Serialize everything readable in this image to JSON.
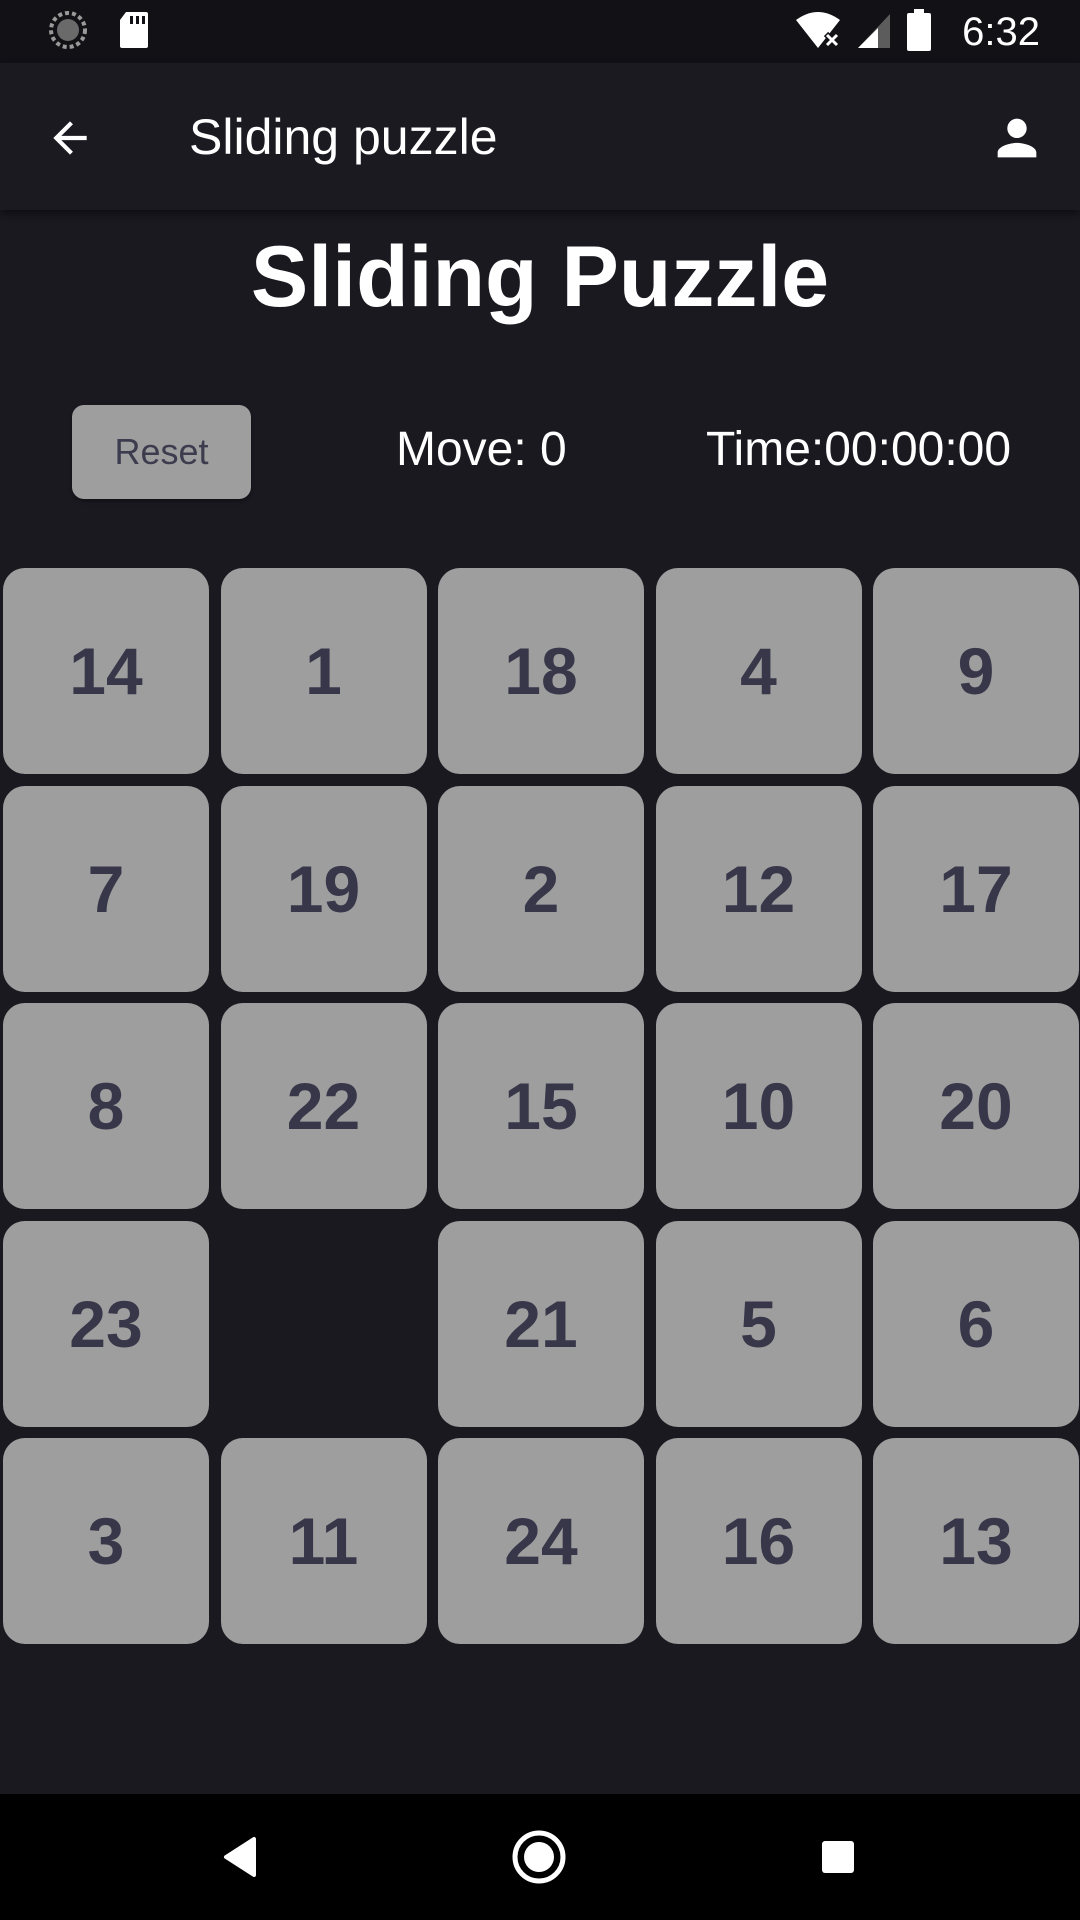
{
  "status_bar": {
    "time": "6:32",
    "icons": [
      "sync-icon",
      "sd-card-icon",
      "wifi-off-icon",
      "signal-icon",
      "battery-icon"
    ]
  },
  "app_bar": {
    "title": "Sliding puzzle",
    "back_icon": "arrow-back-icon",
    "profile_icon": "person-icon"
  },
  "game": {
    "heading": "Sliding Puzzle",
    "reset_label": "Reset",
    "moves_text": "Move: 0",
    "timer_text": "Time:00:00:00",
    "tiles": [
      "14",
      "1",
      "18",
      "4",
      "9",
      "7",
      "19",
      "2",
      "12",
      "17",
      "8",
      "22",
      "15",
      "10",
      "20",
      "23",
      "",
      "21",
      "5",
      "6",
      "3",
      "11",
      "24",
      "16",
      "13"
    ]
  },
  "colors": {
    "background": "#1a1920",
    "app_bar": "#1b1a21",
    "tile": "#9e9e9e",
    "tile_text": "#383649"
  },
  "nav_bar": {
    "icons": [
      "back-triangle-icon",
      "home-circle-icon",
      "recents-square-icon"
    ]
  }
}
